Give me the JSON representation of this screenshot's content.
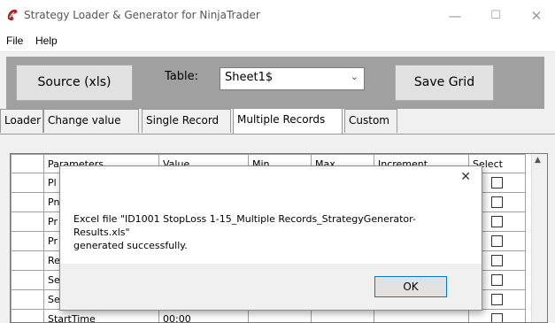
{
  "window": {
    "title": "Strategy Loader & Generator for NinjaTrader",
    "minimize_glyph": "—",
    "maximize_glyph": "☐",
    "close_glyph": "✕"
  },
  "menu": {
    "items": [
      "File",
      "Help"
    ]
  },
  "toolbar": {
    "source_label": "Source (xls)",
    "table_label": "Table:",
    "table_value": "Sheet1$",
    "save_label": "Save Grid"
  },
  "tabs": [
    {
      "label": "Loader",
      "active": false
    },
    {
      "label": "Change value",
      "active": false
    },
    {
      "label": "Single Record",
      "active": false
    },
    {
      "label": "Multiple Records",
      "active": true
    },
    {
      "label": "Custom",
      "active": false
    }
  ],
  "grid": {
    "columns": [
      "Parameters",
      "Value",
      "Min",
      "Max",
      "Increment",
      "Select"
    ],
    "rows": [
      {
        "param": "Pl",
        "value": ""
      },
      {
        "param": "Pn",
        "value": ""
      },
      {
        "param": "Pr",
        "value": ""
      },
      {
        "param": "Pr",
        "value": ""
      },
      {
        "param": "Re",
        "value": ""
      },
      {
        "param": "Se",
        "value": ""
      },
      {
        "param": "Se",
        "value": ""
      },
      {
        "param": "StartTime",
        "value": "00:00"
      }
    ]
  },
  "dialog": {
    "message_line1": "Excel file \"ID1001 StopLoss 1-15_Multiple Records_StrategyGenerator-Results.xls\"",
    "message_line2": "generated successfully.",
    "ok_label": "OK",
    "close_glyph": "✕"
  },
  "colors": {
    "toolbar_bg": "#a0a0a0",
    "ok_border": "#0078d7"
  }
}
